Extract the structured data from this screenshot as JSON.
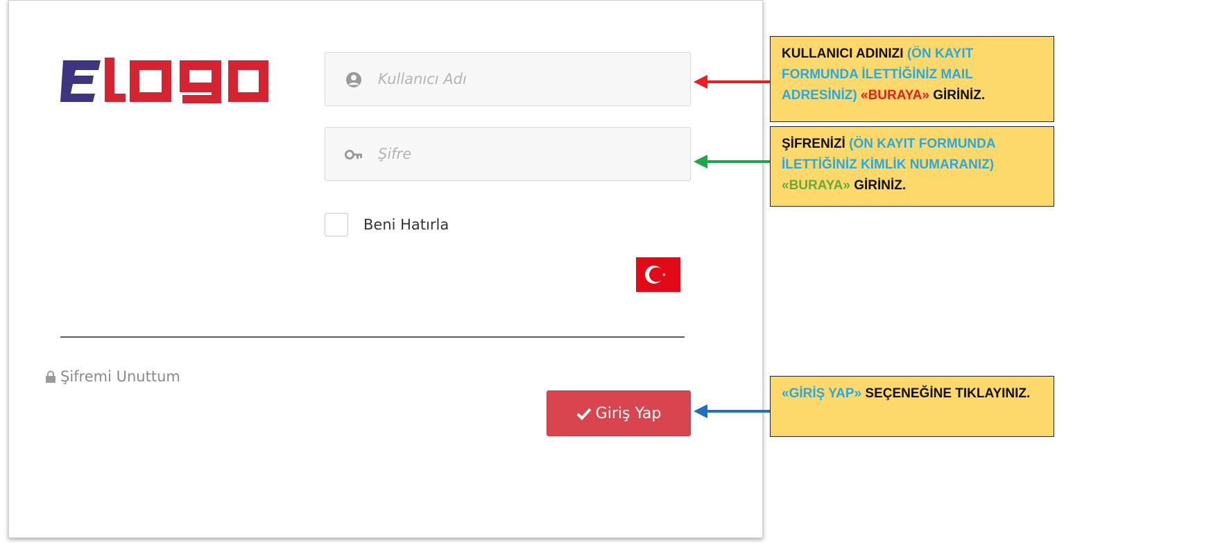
{
  "login": {
    "username_placeholder": "Kullanıcı Adı",
    "password_placeholder": "Şifre",
    "remember_label": "Beni Hatırla",
    "forgot_label": "Şifremi Unuttum",
    "login_button_label": "Giriş Yap",
    "button_color": "#d9454f"
  },
  "icons": {
    "username": "user-circle-icon",
    "password": "key-icon",
    "forgot": "lock-icon",
    "button": "check-icon",
    "language": "turkish-flag-icon"
  },
  "colors": {
    "callout_bg": "#fcd96a",
    "arrow_user": "#ee1c1c",
    "arrow_password": "#1aa84a",
    "arrow_button": "#1f6fc2",
    "highlight_blue": "#2aa9e0",
    "highlight_red": "#ee1c1c",
    "highlight_green": "#6aaa3a",
    "logo_blue": "#3d3580",
    "logo_red": "#d42431"
  },
  "annotations": {
    "user": {
      "part1": "KULLANICI ADINIZI ",
      "part2": "(ÖN KAYIT FORMUNDA İLETTİĞİNİZ MAIL ADRESİNİZ) ",
      "part3": "«BURAYA»",
      "part4": " GİRİNİZ."
    },
    "password": {
      "part1": "ŞİFRENİZİ ",
      "part2": "(ÖN KAYIT FORMUNDA İLETTİĞİNİZ KİMLİK NUMARANIZ) ",
      "part3": "«BURAYA»",
      "part4": " GİRİNİZ."
    },
    "button": {
      "part1": "«GİRİŞ YAP»",
      "part2": " SEÇENEĞİNE TIKLAYINIZ."
    }
  }
}
